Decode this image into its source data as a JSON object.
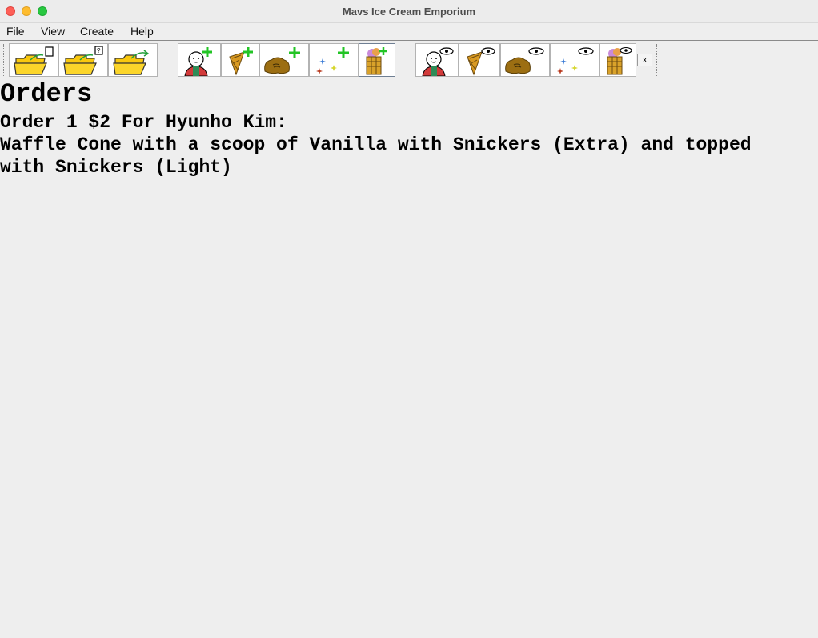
{
  "window": {
    "title": "Mavs Ice Cream Emporium"
  },
  "menu": [
    "File",
    "View",
    "Create",
    "Help"
  ],
  "toolbar": {
    "file_buttons": [
      "new-file-icon",
      "open-file-icon",
      "save-file-icon"
    ],
    "create_buttons": [
      "add-customer-icon",
      "add-container-icon",
      "add-ice-cream-flavor-icon",
      "add-mix-in-icon",
      "add-order-icon"
    ],
    "view_buttons": [
      "view-customers-icon",
      "view-containers-icon",
      "view-ice-cream-flavors-icon",
      "view-mix-ins-icon",
      "view-orders-icon"
    ],
    "close_label": "x"
  },
  "main": {
    "heading": "Orders",
    "orders": [
      {
        "summary": "Order 1 $2 For Hyunho Kim:",
        "lines": [
          "Waffle Cone with a scoop of Vanilla with Snickers (Extra) and topped",
          "with Snickers (Light)"
        ]
      }
    ]
  },
  "colors": {
    "background": "#eeeeee",
    "folder": "#f9c80e",
    "plus": "#22c425",
    "cone": "#d99a22",
    "scoop": "#9c6e12"
  }
}
